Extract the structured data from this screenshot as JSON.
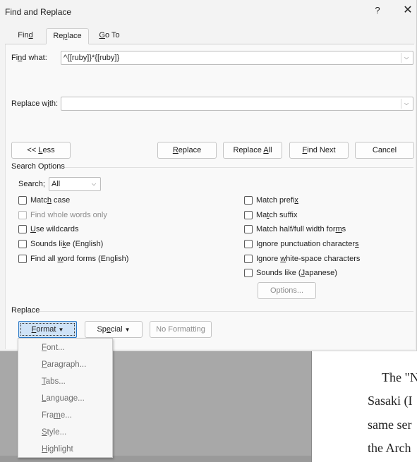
{
  "window": {
    "title": "Find and Replace",
    "help_label": "?",
    "close_label": "✕"
  },
  "tabs": [
    {
      "label": "Find",
      "shortcut": "d",
      "active": false
    },
    {
      "label": "Replace",
      "shortcut": "p",
      "active": true
    },
    {
      "label": "Go To",
      "shortcut": "G",
      "active": false
    }
  ],
  "find": {
    "label": "Find what:",
    "value": "^{[ruby]}*{[ruby]}"
  },
  "replace": {
    "label": "Replace with:",
    "value": ""
  },
  "buttons": {
    "less": "<< Less",
    "replace": "Replace",
    "replace_all": "Replace All",
    "find_next": "Find Next",
    "cancel": "Cancel"
  },
  "search_options": {
    "heading": "Search Options",
    "search_label": "Search;",
    "search_value": "All",
    "left": [
      {
        "label": "Match case",
        "checked": false,
        "enabled": true
      },
      {
        "label": "Find whole words only",
        "checked": false,
        "enabled": false
      },
      {
        "label": "Use wildcards",
        "checked": false,
        "enabled": true
      },
      {
        "label": "Sounds like (English)",
        "checked": false,
        "enabled": true
      },
      {
        "label": "Find all word forms (English)",
        "checked": false,
        "enabled": true
      }
    ],
    "right": [
      {
        "label": "Match prefix",
        "checked": false,
        "enabled": true
      },
      {
        "label": "Match suffix",
        "checked": false,
        "enabled": true
      },
      {
        "label": "Match half/full width forms",
        "checked": false,
        "enabled": true
      },
      {
        "label": "Ignore punctuation characters",
        "checked": false,
        "enabled": true
      },
      {
        "label": "Ignore white-space characters",
        "checked": false,
        "enabled": true
      },
      {
        "label": "Sounds like (Japanese)",
        "checked": false,
        "enabled": true
      }
    ],
    "options_button": "Options..."
  },
  "replace_section": {
    "heading": "Replace",
    "format_button": "Format",
    "special_button": "Special",
    "no_formatting_button": "No Formatting"
  },
  "format_menu": {
    "items": [
      "Font...",
      "Paragraph...",
      "Tabs...",
      "Language...",
      "Frame...",
      "Style...",
      "Highlight"
    ]
  },
  "background_document": {
    "lines": [
      "The \"N",
      "Sasaki (I",
      "same ser",
      "the Arch"
    ]
  },
  "colors": {
    "dialog_bg": "#f3f3f3",
    "format_highlight": "#cfe3f7",
    "format_border": "#2a78c6",
    "disabled_text": "#8c8c8c"
  }
}
